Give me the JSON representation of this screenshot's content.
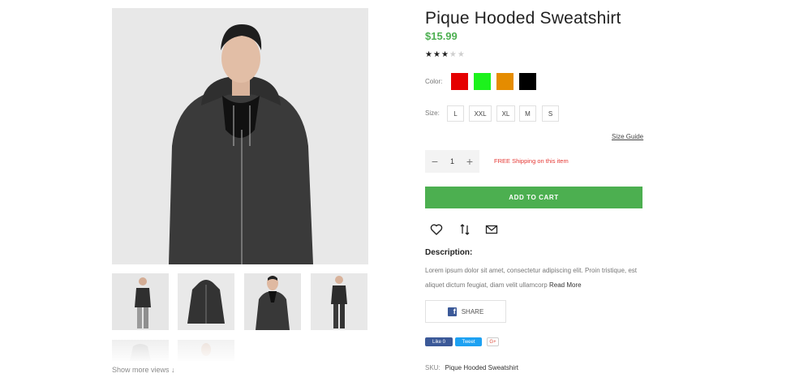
{
  "product": {
    "title": "Pique Hooded Sweatshirt",
    "price": "$15.99",
    "rating": 3,
    "rating_max": 5
  },
  "gallery": {
    "show_more": "Show more views ↓"
  },
  "color": {
    "label": "Color:",
    "swatches": [
      "#e50000",
      "#1cf21c",
      "#e58c00",
      "#000000"
    ]
  },
  "size": {
    "label": "Size:",
    "options": [
      "L",
      "XXL",
      "XL",
      "M",
      "S"
    ]
  },
  "size_guide": "Size Guide",
  "quantity": {
    "value": "1",
    "minus": "−",
    "plus": "+"
  },
  "shipping": "FREE Shipping on this item",
  "add_to_cart": "ADD TO CART",
  "actions": [
    "heart-icon",
    "compare-icon",
    "mail-icon"
  ],
  "description": {
    "heading": "Description:",
    "text": "Lorem ipsum dolor sit amet, consectetur adipiscing elit. Proin tristique, est aliquet dictum feugiat, diam velit ullamcorp",
    "more": "Read More"
  },
  "share": {
    "label": "SHARE"
  },
  "social": {
    "like": "Like 0",
    "tweet": "Tweet",
    "gplus": "G+"
  },
  "sku": {
    "label": "SKU:",
    "value": "Pique Hooded Sweatshirt"
  },
  "colors": {
    "accent": "#4caf50",
    "shipping": "#e53935",
    "facebook": "#3b5998",
    "twitter": "#1da1f2"
  }
}
